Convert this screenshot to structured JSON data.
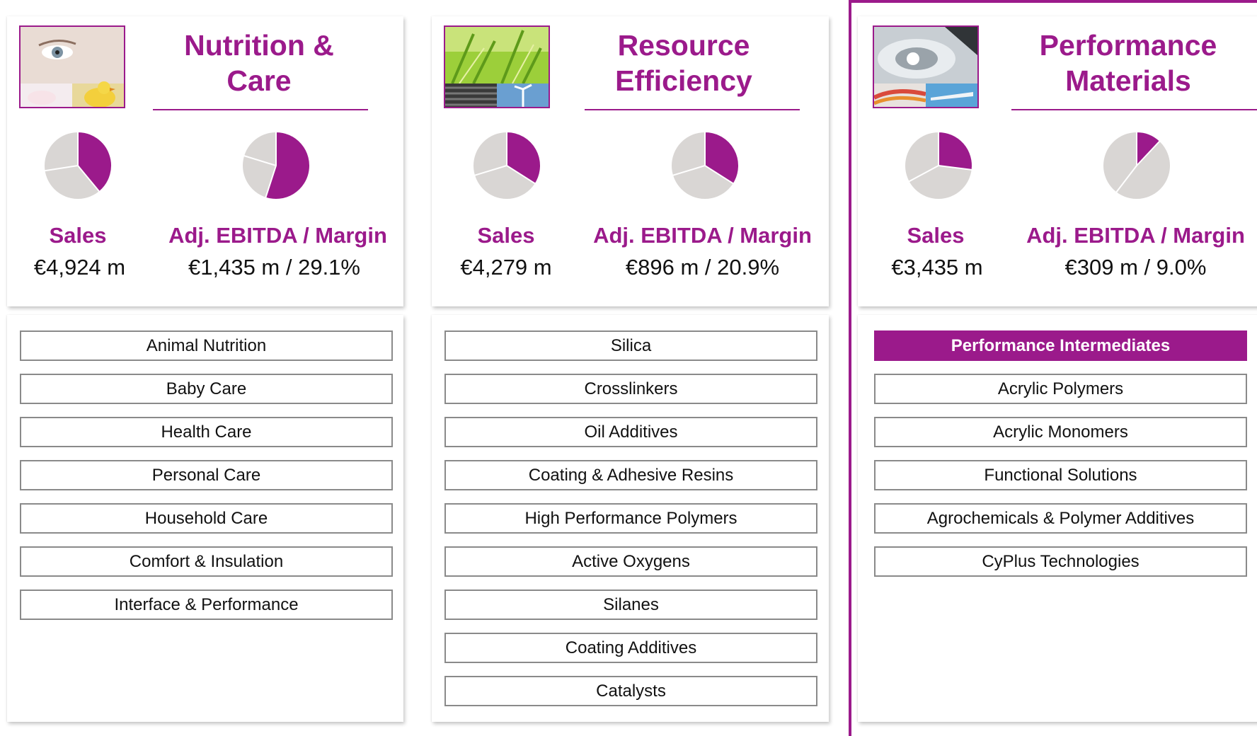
{
  "colors": {
    "accent": "#9b1a8b",
    "pie_gray": "#d9d6d4",
    "pie_edge": "#ffffff"
  },
  "segments": [
    {
      "title": "Nutrition & Care",
      "photo": "skincare-and-chick-photo",
      "sales_label": "Sales",
      "sales_value": "€4,924 m",
      "ebitda_label": "Adj. EBITDA / Margin",
      "ebitda_value": "€1,435 m / 29.1%",
      "units": [
        "Animal Nutrition",
        "Baby Care",
        "Health Care",
        "Personal Care",
        "Household Care",
        "Comfort & Insulation",
        "Interface & Performance"
      ],
      "active_unit": null
    },
    {
      "title": "Resource Efficiency",
      "photo": "grass-tires-wind-photo",
      "sales_label": "Sales",
      "sales_value": "€4,279 m",
      "ebitda_label": "Adj. EBITDA / Margin",
      "ebitda_value": "€896 m / 20.9%",
      "units": [
        "Silica",
        "Crosslinkers",
        "Oil Additives",
        "Coating & Adhesive Resins",
        "High Performance Polymers",
        "Active Oxygens",
        "Silanes",
        "Coating Additives",
        "Catalysts"
      ],
      "active_unit": null
    },
    {
      "title": "Performance Materials",
      "photo": "headlight-and-wings-photo",
      "sales_label": "Sales",
      "sales_value": "€3,435 m",
      "ebitda_label": "Adj. EBITDA / Margin",
      "ebitda_value": "€309 m / 9.0%",
      "units": [
        "Performance Intermediates",
        "Acrylic Polymers",
        "Acrylic Monomers",
        "Functional Solutions",
        "Agrochemicals & Polymer Additives",
        "CyPlus Technologies"
      ],
      "active_unit": 0
    }
  ],
  "chart_data": [
    {
      "type": "pie",
      "segment": "Nutrition & Care",
      "metric": "Sales",
      "highlight_share": 0.39
    },
    {
      "type": "pie",
      "segment": "Nutrition & Care",
      "metric": "Adj. EBITDA / Margin",
      "highlight_share": 0.55
    },
    {
      "type": "pie",
      "segment": "Resource Efficiency",
      "metric": "Sales",
      "highlight_share": 0.34
    },
    {
      "type": "pie",
      "segment": "Resource Efficiency",
      "metric": "Adj. EBITDA / Margin",
      "highlight_share": 0.34
    },
    {
      "type": "pie",
      "segment": "Performance Materials",
      "metric": "Sales",
      "highlight_share": 0.27
    },
    {
      "type": "pie",
      "segment": "Performance Materials",
      "metric": "Adj. EBITDA / Margin",
      "highlight_share": 0.12
    }
  ]
}
